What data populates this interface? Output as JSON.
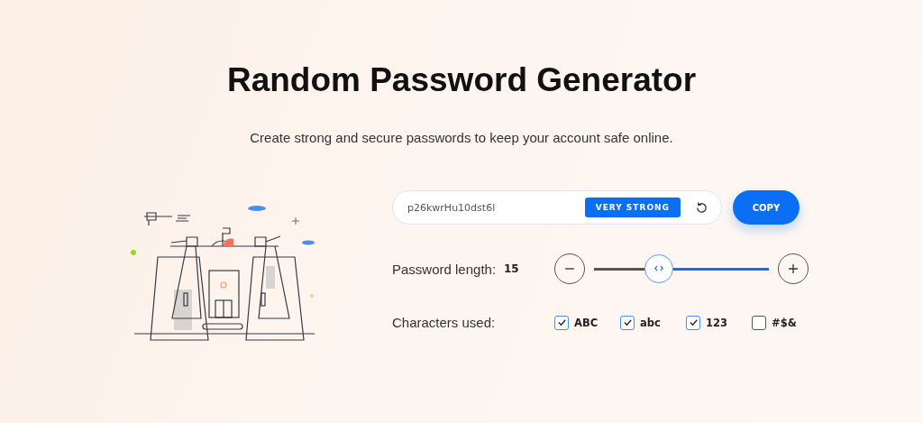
{
  "title": "Random Password Generator",
  "subtitle": "Create strong and secure passwords to keep your account safe online.",
  "password": {
    "value": "p26kwrHu10dst6l",
    "strength": "VERY STRONG"
  },
  "copy_button": "COPY",
  "length": {
    "label": "Password length:",
    "value": "15",
    "level": 0.32
  },
  "characters": {
    "label": "Characters used:",
    "options": [
      {
        "label": "ABC",
        "checked": true
      },
      {
        "label": "abc",
        "checked": true
      },
      {
        "label": "123",
        "checked": true
      },
      {
        "label": "#$&",
        "checked": false
      }
    ]
  }
}
